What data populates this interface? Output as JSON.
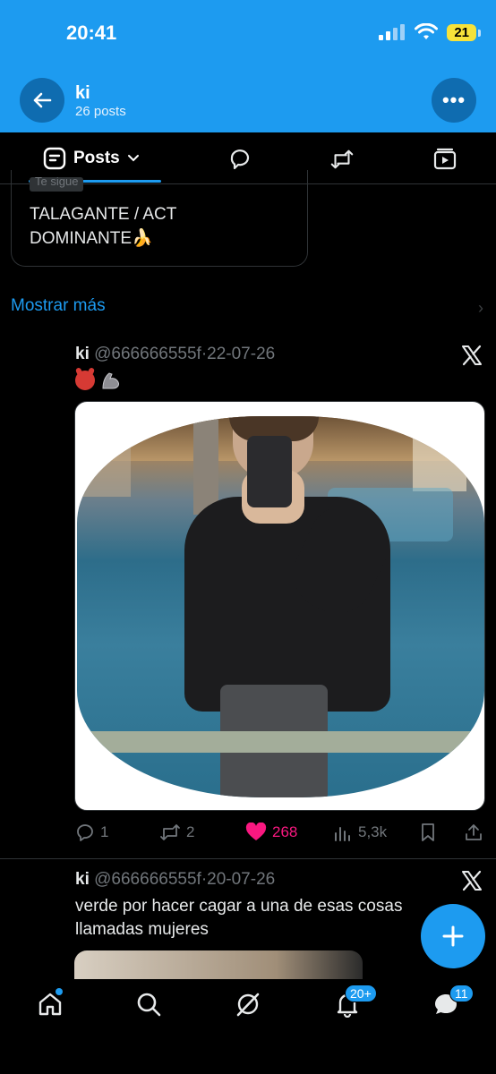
{
  "status_bar": {
    "time": "20:41",
    "battery": "21"
  },
  "header": {
    "title": "ki",
    "subtitle": "26 posts"
  },
  "tabs": {
    "posts_label": "Posts"
  },
  "quote_card": {
    "follows_badge": "Te sigue",
    "text": "TALAGANTE / ACT DOMINANTE🍌"
  },
  "show_more": {
    "label": "Mostrar más"
  },
  "tweet1": {
    "author": "ki",
    "handle": "@666666555f",
    "separator": "·",
    "date": "22-07-26",
    "emojis": [
      "devil-emoji",
      "flexed-biceps-emoji"
    ],
    "actions": {
      "replies": "1",
      "reposts": "2",
      "likes": "268",
      "views": "5,3k"
    }
  },
  "tweet2": {
    "author": "ki",
    "handle": "@666666555f",
    "separator": "·",
    "date": "20-07-26",
    "text": "verde por hacer cagar a una de esas cosas llamadas mujeres"
  },
  "bottom_nav": {
    "notifications_badge": "20+",
    "messages_badge": "11"
  },
  "colors": {
    "accent": "#1d9bf0",
    "like": "#f91880",
    "muted": "#71767b",
    "background": "#000000"
  }
}
